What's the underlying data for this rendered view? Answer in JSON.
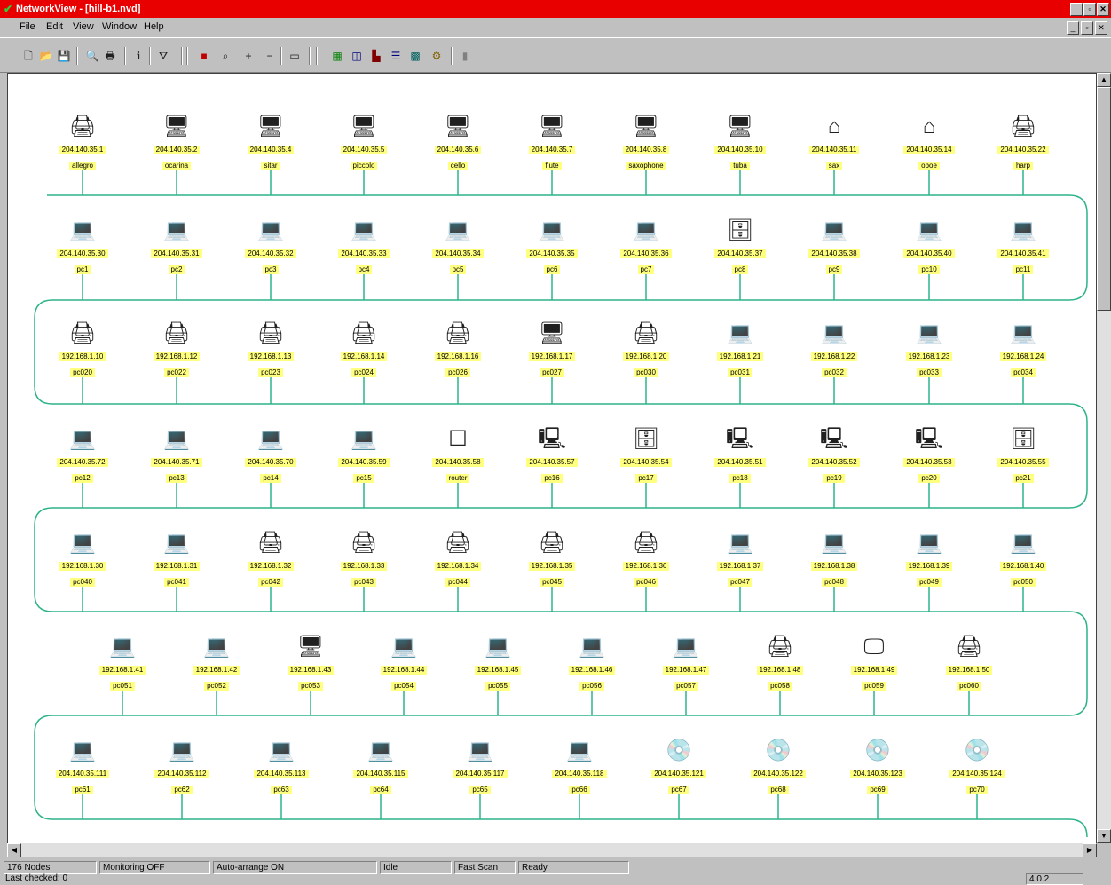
{
  "window": {
    "title": "NetworkView - [hill-b1.nvd]",
    "buttons": [
      "_",
      "▫",
      "✕"
    ],
    "mdi_buttons": [
      "_",
      "▫",
      "✕"
    ]
  },
  "menu": [
    "File",
    "Edit",
    "View",
    "Window",
    "Help"
  ],
  "toolbar": {
    "groups": [
      [
        "new-file-icon",
        "open-file-icon",
        "save-icon"
      ],
      [
        "print-preview-icon",
        "print-icon"
      ],
      [
        "info-icon",
        "filter-icon"
      ],
      [
        "color-icon",
        "zoom-icon",
        "zoom-in-icon",
        "zoom-out-icon",
        "window-icon"
      ],
      [
        "view1-icon",
        "view2-icon",
        "chart-icon",
        "list-icon",
        "grid-icon",
        "settings-icon"
      ],
      [
        "pause-icon"
      ]
    ]
  },
  "network": {
    "line_color": "#2db38a",
    "label_bg": "#ffff80",
    "rows": [
      {
        "nodes": [
          {
            "ip": "204.140.35.1",
            "name": "allegro",
            "icon": "printer"
          },
          {
            "ip": "204.140.35.2",
            "name": "ocarina",
            "icon": "server"
          },
          {
            "ip": "204.140.35.4",
            "name": "sitar",
            "icon": "server"
          },
          {
            "ip": "204.140.35.5",
            "name": "piccolo",
            "icon": "server"
          },
          {
            "ip": "204.140.35.6",
            "name": "cello",
            "icon": "server"
          },
          {
            "ip": "204.140.35.7",
            "name": "flute",
            "icon": "server"
          },
          {
            "ip": "204.140.35.8",
            "name": "saxophone",
            "icon": "server"
          },
          {
            "ip": "204.140.35.10",
            "name": "tuba",
            "icon": "server"
          },
          {
            "ip": "204.140.35.11",
            "name": "sax",
            "icon": "router"
          },
          {
            "ip": "204.140.35.14",
            "name": "oboe",
            "icon": "router"
          },
          {
            "ip": "204.140.35.22",
            "name": "harp",
            "icon": "printer"
          }
        ]
      },
      {
        "nodes": [
          {
            "ip": "204.140.35.30",
            "name": "pc1",
            "icon": "workstation"
          },
          {
            "ip": "204.140.35.31",
            "name": "pc2",
            "icon": "workstation"
          },
          {
            "ip": "204.140.35.32",
            "name": "pc3",
            "icon": "workstation"
          },
          {
            "ip": "204.140.35.33",
            "name": "pc4",
            "icon": "workstation"
          },
          {
            "ip": "204.140.35.34",
            "name": "pc5",
            "icon": "workstation"
          },
          {
            "ip": "204.140.35.35",
            "name": "pc6",
            "icon": "workstation"
          },
          {
            "ip": "204.140.35.36",
            "name": "pc7",
            "icon": "workstation"
          },
          {
            "ip": "204.140.35.37",
            "name": "pc8",
            "icon": "hub"
          },
          {
            "ip": "204.140.35.38",
            "name": "pc9",
            "icon": "workstation"
          },
          {
            "ip": "204.140.35.40",
            "name": "pc10",
            "icon": "workstation"
          },
          {
            "ip": "204.140.35.41",
            "name": "pc11",
            "icon": "workstation"
          }
        ]
      },
      {
        "nodes": [
          {
            "ip": "192.168.1.10",
            "name": "pc020",
            "icon": "printer"
          },
          {
            "ip": "192.168.1.12",
            "name": "pc022",
            "icon": "printer"
          },
          {
            "ip": "192.168.1.13",
            "name": "pc023",
            "icon": "printer"
          },
          {
            "ip": "192.168.1.14",
            "name": "pc024",
            "icon": "printer"
          },
          {
            "ip": "192.168.1.16",
            "name": "pc026",
            "icon": "printer"
          },
          {
            "ip": "192.168.1.17",
            "name": "pc027",
            "icon": "server"
          },
          {
            "ip": "192.168.1.20",
            "name": "pc030",
            "icon": "printer"
          },
          {
            "ip": "192.168.1.21",
            "name": "pc031",
            "icon": "workstation"
          },
          {
            "ip": "192.168.1.22",
            "name": "pc032",
            "icon": "workstation"
          },
          {
            "ip": "192.168.1.23",
            "name": "pc033",
            "icon": "workstation"
          },
          {
            "ip": "192.168.1.24",
            "name": "pc034",
            "icon": "workstation"
          }
        ]
      },
      {
        "nodes": [
          {
            "ip": "204.140.35.72",
            "name": "pc12",
            "icon": "laptop"
          },
          {
            "ip": "204.140.35.71",
            "name": "pc13",
            "icon": "laptop"
          },
          {
            "ip": "204.140.35.70",
            "name": "pc14",
            "icon": "laptop"
          },
          {
            "ip": "204.140.35.59",
            "name": "pc15",
            "icon": "laptop"
          },
          {
            "ip": "204.140.35.58",
            "name": "router",
            "icon": "router-box"
          },
          {
            "ip": "204.140.35.57",
            "name": "pc16",
            "icon": "desktop"
          },
          {
            "ip": "204.140.35.54",
            "name": "pc17",
            "icon": "hub"
          },
          {
            "ip": "204.140.35.51",
            "name": "pc18",
            "icon": "desktop"
          },
          {
            "ip": "204.140.35.52",
            "name": "pc19",
            "icon": "desktop"
          },
          {
            "ip": "204.140.35.53",
            "name": "pc20",
            "icon": "desktop"
          },
          {
            "ip": "204.140.35.55",
            "name": "pc21",
            "icon": "hub"
          }
        ]
      },
      {
        "nodes": [
          {
            "ip": "192.168.1.30",
            "name": "pc040",
            "icon": "workstation"
          },
          {
            "ip": "192.168.1.31",
            "name": "pc041",
            "icon": "workstation"
          },
          {
            "ip": "192.168.1.32",
            "name": "pc042",
            "icon": "scanner"
          },
          {
            "ip": "192.168.1.33",
            "name": "pc043",
            "icon": "scanner"
          },
          {
            "ip": "192.168.1.34",
            "name": "pc044",
            "icon": "scanner"
          },
          {
            "ip": "192.168.1.35",
            "name": "pc045",
            "icon": "scanner"
          },
          {
            "ip": "192.168.1.36",
            "name": "pc046",
            "icon": "scanner"
          },
          {
            "ip": "192.168.1.37",
            "name": "pc047",
            "icon": "workstation"
          },
          {
            "ip": "192.168.1.38",
            "name": "pc048",
            "icon": "workstation"
          },
          {
            "ip": "192.168.1.39",
            "name": "pc049",
            "icon": "workstation"
          },
          {
            "ip": "192.168.1.40",
            "name": "pc050",
            "icon": "workstation"
          }
        ]
      },
      {
        "nodes": [
          {
            "ip": "192.168.1.41",
            "name": "pc051",
            "icon": "workstation"
          },
          {
            "ip": "192.168.1.42",
            "name": "pc052",
            "icon": "workstation"
          },
          {
            "ip": "192.168.1.43",
            "name": "pc053",
            "icon": "server"
          },
          {
            "ip": "192.168.1.44",
            "name": "pc054",
            "icon": "workstation"
          },
          {
            "ip": "192.168.1.45",
            "name": "pc055",
            "icon": "workstation"
          },
          {
            "ip": "192.168.1.46",
            "name": "pc056",
            "icon": "workstation"
          },
          {
            "ip": "192.168.1.47",
            "name": "pc057",
            "icon": "workstation"
          },
          {
            "ip": "192.168.1.48",
            "name": "pc058",
            "icon": "printer"
          },
          {
            "ip": "192.168.1.49",
            "name": "pc059",
            "icon": "monitor"
          },
          {
            "ip": "192.168.1.50",
            "name": "pc060",
            "icon": "printer"
          }
        ]
      },
      {
        "nodes": [
          {
            "ip": "204.140.35.111",
            "name": "pc61",
            "icon": "laptop"
          },
          {
            "ip": "204.140.35.112",
            "name": "pc62",
            "icon": "laptop"
          },
          {
            "ip": "204.140.35.113",
            "name": "pc63",
            "icon": "laptop"
          },
          {
            "ip": "204.140.35.115",
            "name": "pc64",
            "icon": "laptop"
          },
          {
            "ip": "204.140.35.117",
            "name": "pc65",
            "icon": "laptop"
          },
          {
            "ip": "204.140.35.118",
            "name": "pc66",
            "icon": "laptop"
          },
          {
            "ip": "204.140.35.121",
            "name": "pc67",
            "icon": "disc"
          },
          {
            "ip": "204.140.35.122",
            "name": "pc68",
            "icon": "disc"
          },
          {
            "ip": "204.140.35.123",
            "name": "pc69",
            "icon": "disc"
          },
          {
            "ip": "204.140.35.124",
            "name": "pc70",
            "icon": "disc"
          }
        ]
      }
    ]
  },
  "status": {
    "panes": [
      "176 Nodes",
      "Monitoring OFF",
      "Auto-arrange ON",
      "Idle",
      "Fast Scan",
      "Ready"
    ],
    "line2": "Last checked: 0",
    "right": "4.0.2"
  }
}
